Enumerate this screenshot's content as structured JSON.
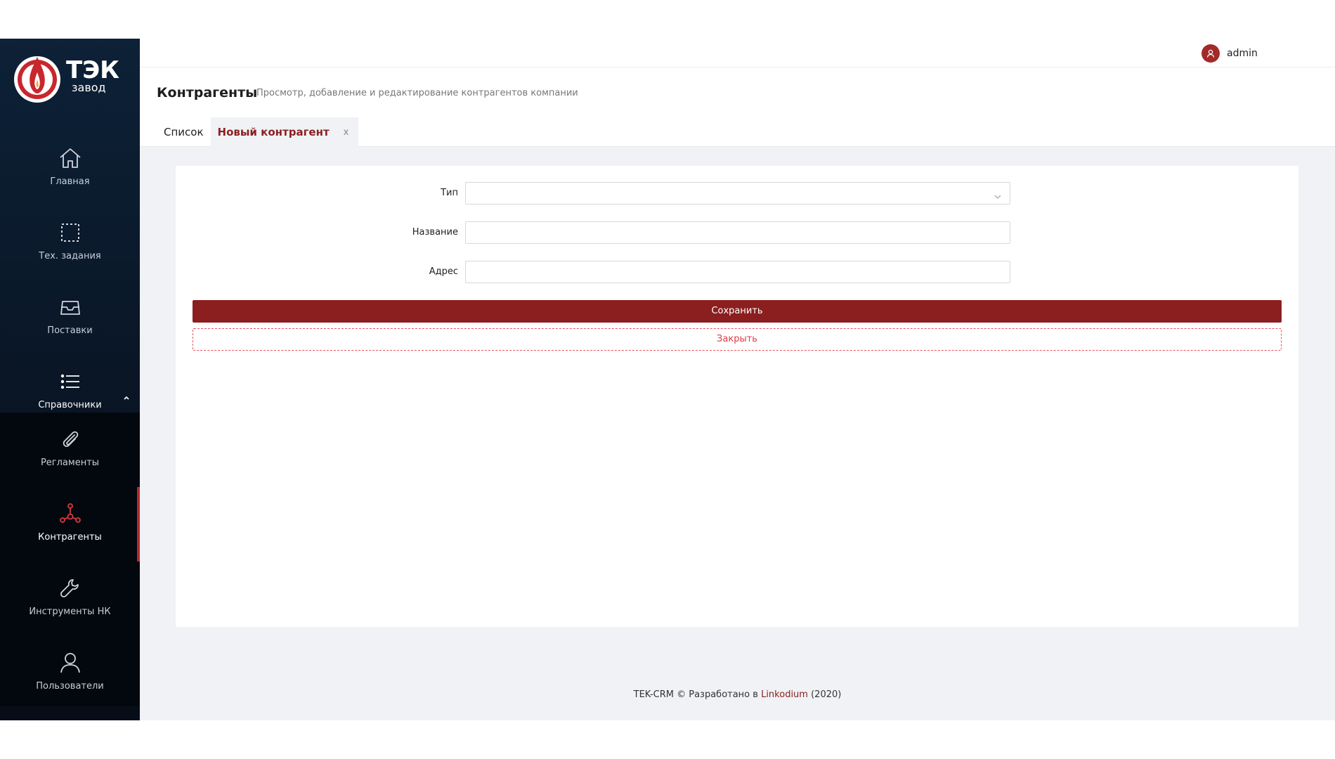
{
  "user": {
    "name": "admin"
  },
  "logo": {
    "text": "ТЭК",
    "subtext": "завод"
  },
  "sidebar": {
    "items": [
      {
        "label": "Главная",
        "icon": "home-icon"
      },
      {
        "label": "Тех. задания",
        "icon": "selection-icon"
      },
      {
        "label": "Поставки",
        "icon": "inbox-icon"
      },
      {
        "label": "Справочники",
        "icon": "list-icon"
      },
      {
        "label": "Регламенты",
        "icon": "paperclip-icon"
      },
      {
        "label": "Контрагенты",
        "icon": "nodes-icon"
      },
      {
        "label": "Инструменты НК",
        "icon": "wrench-icon"
      },
      {
        "label": "Пользователи",
        "icon": "user-icon"
      }
    ],
    "active": "Контрагенты"
  },
  "page": {
    "title": "Контрагенты",
    "subtitle": "Просмотр, добавление и редактирование контрагентов компании"
  },
  "tabs": {
    "list": "Список",
    "new": "Новый контрагент",
    "close": "x"
  },
  "form": {
    "type_label": "Тип",
    "type_value": "",
    "name_label": "Название",
    "name_value": "",
    "address_label": "Адрес",
    "address_value": "",
    "save_label": "Сохранить",
    "close_label": "Закрыть"
  },
  "footer": {
    "prefix": "TEK-CRM © Разработано в",
    "link": "Linkodium",
    "suffix": "(2020)"
  },
  "colors": {
    "accent": "#8b1f1f",
    "danger": "#e03b43",
    "sidebar_bg": "#0a1727"
  }
}
